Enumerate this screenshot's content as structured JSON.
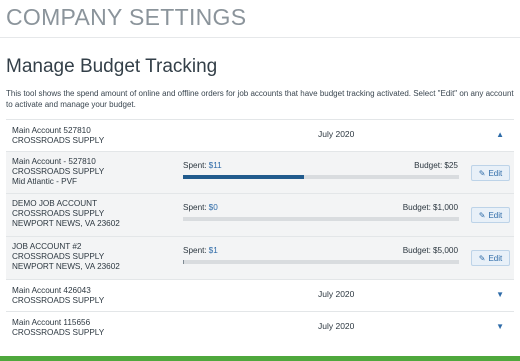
{
  "page": {
    "header": "COMPANY SETTINGS",
    "title": "Manage Budget Tracking",
    "description": "This tool shows the spend amount of online and offline orders for job accounts that have budget tracking activated. Select \"Edit\" on any account to activate and manage your budget."
  },
  "accounts": [
    {
      "line1": "Main Account 527810",
      "line2": "CROSSROADS SUPPLY",
      "period": "July 2020",
      "chevron": "chevron-up-icon",
      "expanded": true
    },
    {
      "line1": "Main Account 426043",
      "line2": "CROSSROADS SUPPLY",
      "period": "July 2020",
      "chevron": "chevron-down-icon",
      "expanded": false
    },
    {
      "line1": "Main Account 115656",
      "line2": "CROSSROADS SUPPLY",
      "period": "July 2020",
      "chevron": "chevron-down-icon",
      "expanded": false
    }
  ],
  "budget_rows": [
    {
      "line1": "Main Account - 527810",
      "line2": "CROSSROADS SUPPLY",
      "line3": "Mid Atlantic - PVF",
      "spent_label": "Spent:",
      "spent_value": "$11",
      "budget_label": "Budget:",
      "budget_value": "$25",
      "progress_fraction": 0.44,
      "edit_label": "Edit"
    },
    {
      "line1": "DEMO JOB ACCOUNT",
      "line2": "CROSSROADS SUPPLY",
      "line3": "NEWPORT NEWS, VA 23602",
      "spent_label": "Spent:",
      "spent_value": "$0",
      "budget_label": "Budget:",
      "budget_value": "$1,000",
      "progress_fraction": 0,
      "edit_label": "Edit"
    },
    {
      "line1": "JOB ACCOUNT #2",
      "line2": "CROSSROADS SUPPLY",
      "line3": "NEWPORT NEWS, VA 23602",
      "spent_label": "Spent:",
      "spent_value": "$1",
      "budget_label": "Budget:",
      "budget_value": "$5,000",
      "progress_fraction": 0.0002,
      "edit_label": "Edit"
    }
  ],
  "colors": {
    "accent": "#2e6ba8",
    "progress_fill": "#215b8d",
    "bottom_bar": "#4fa83d"
  }
}
